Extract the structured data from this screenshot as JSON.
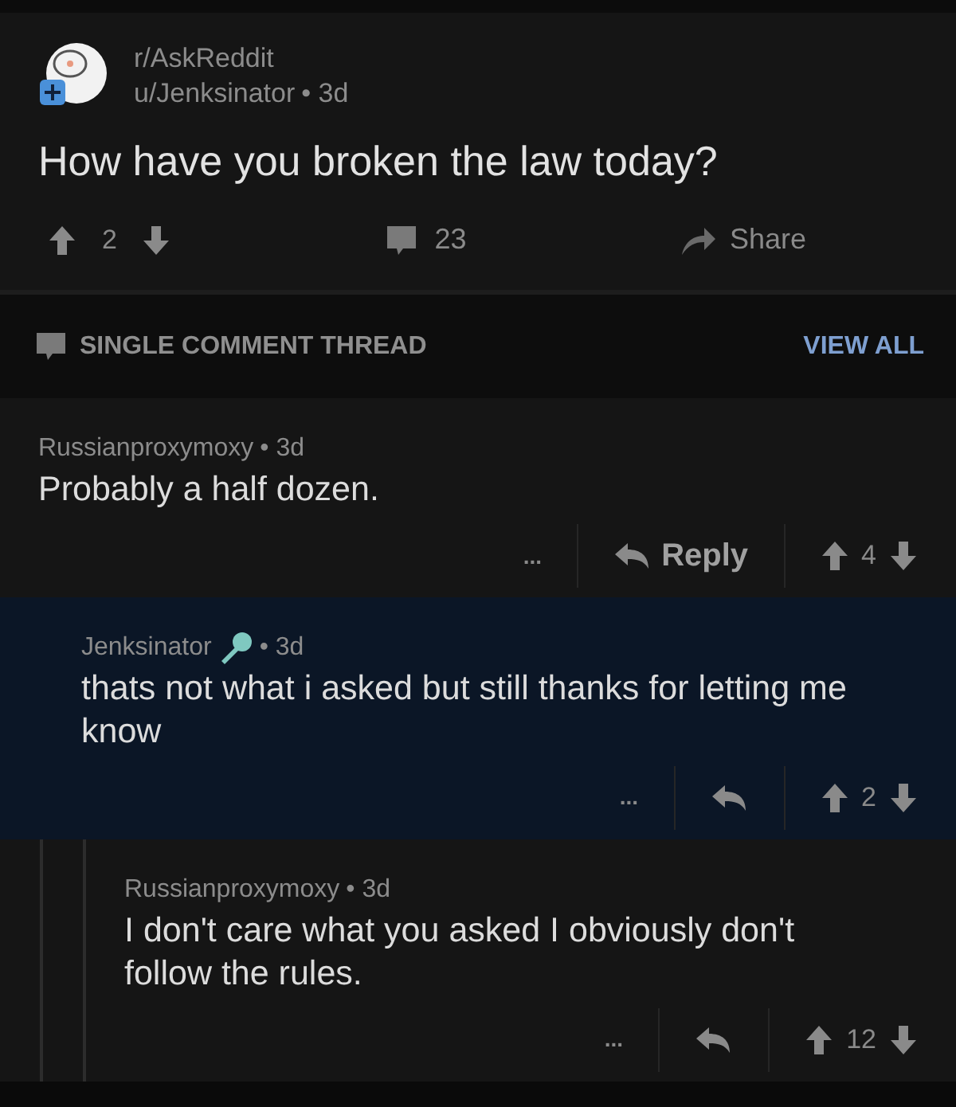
{
  "post": {
    "subreddit": "r/AskReddit",
    "author": "u/Jenksinator",
    "time": "• 3d",
    "title": "How have you broken the law today?",
    "score": "2",
    "comments": "23",
    "share": "Share"
  },
  "thread_bar": {
    "label": "SINGLE COMMENT THREAD",
    "action": "VIEW ALL"
  },
  "comments": [
    {
      "author": "Russianproxymoxy",
      "time": "• 3d",
      "body": "Probably a half dozen.",
      "highlighted": false,
      "flair_icon": false,
      "more": "...",
      "reply_label": "Reply",
      "score": "4",
      "children": [
        {
          "author": "Jenksinator",
          "time": "• 3d",
          "body": "thats not what i asked but still thanks for letting me know",
          "highlighted": true,
          "flair_icon": true,
          "more": "...",
          "score": "2",
          "children": [
            {
              "author": "Russianproxymoxy",
              "time": "• 3d",
              "body": "I don't care what you asked I obviously don't follow the rules.",
              "highlighted": false,
              "flair_icon": false,
              "more": "...",
              "score": "12"
            }
          ]
        }
      ]
    }
  ]
}
